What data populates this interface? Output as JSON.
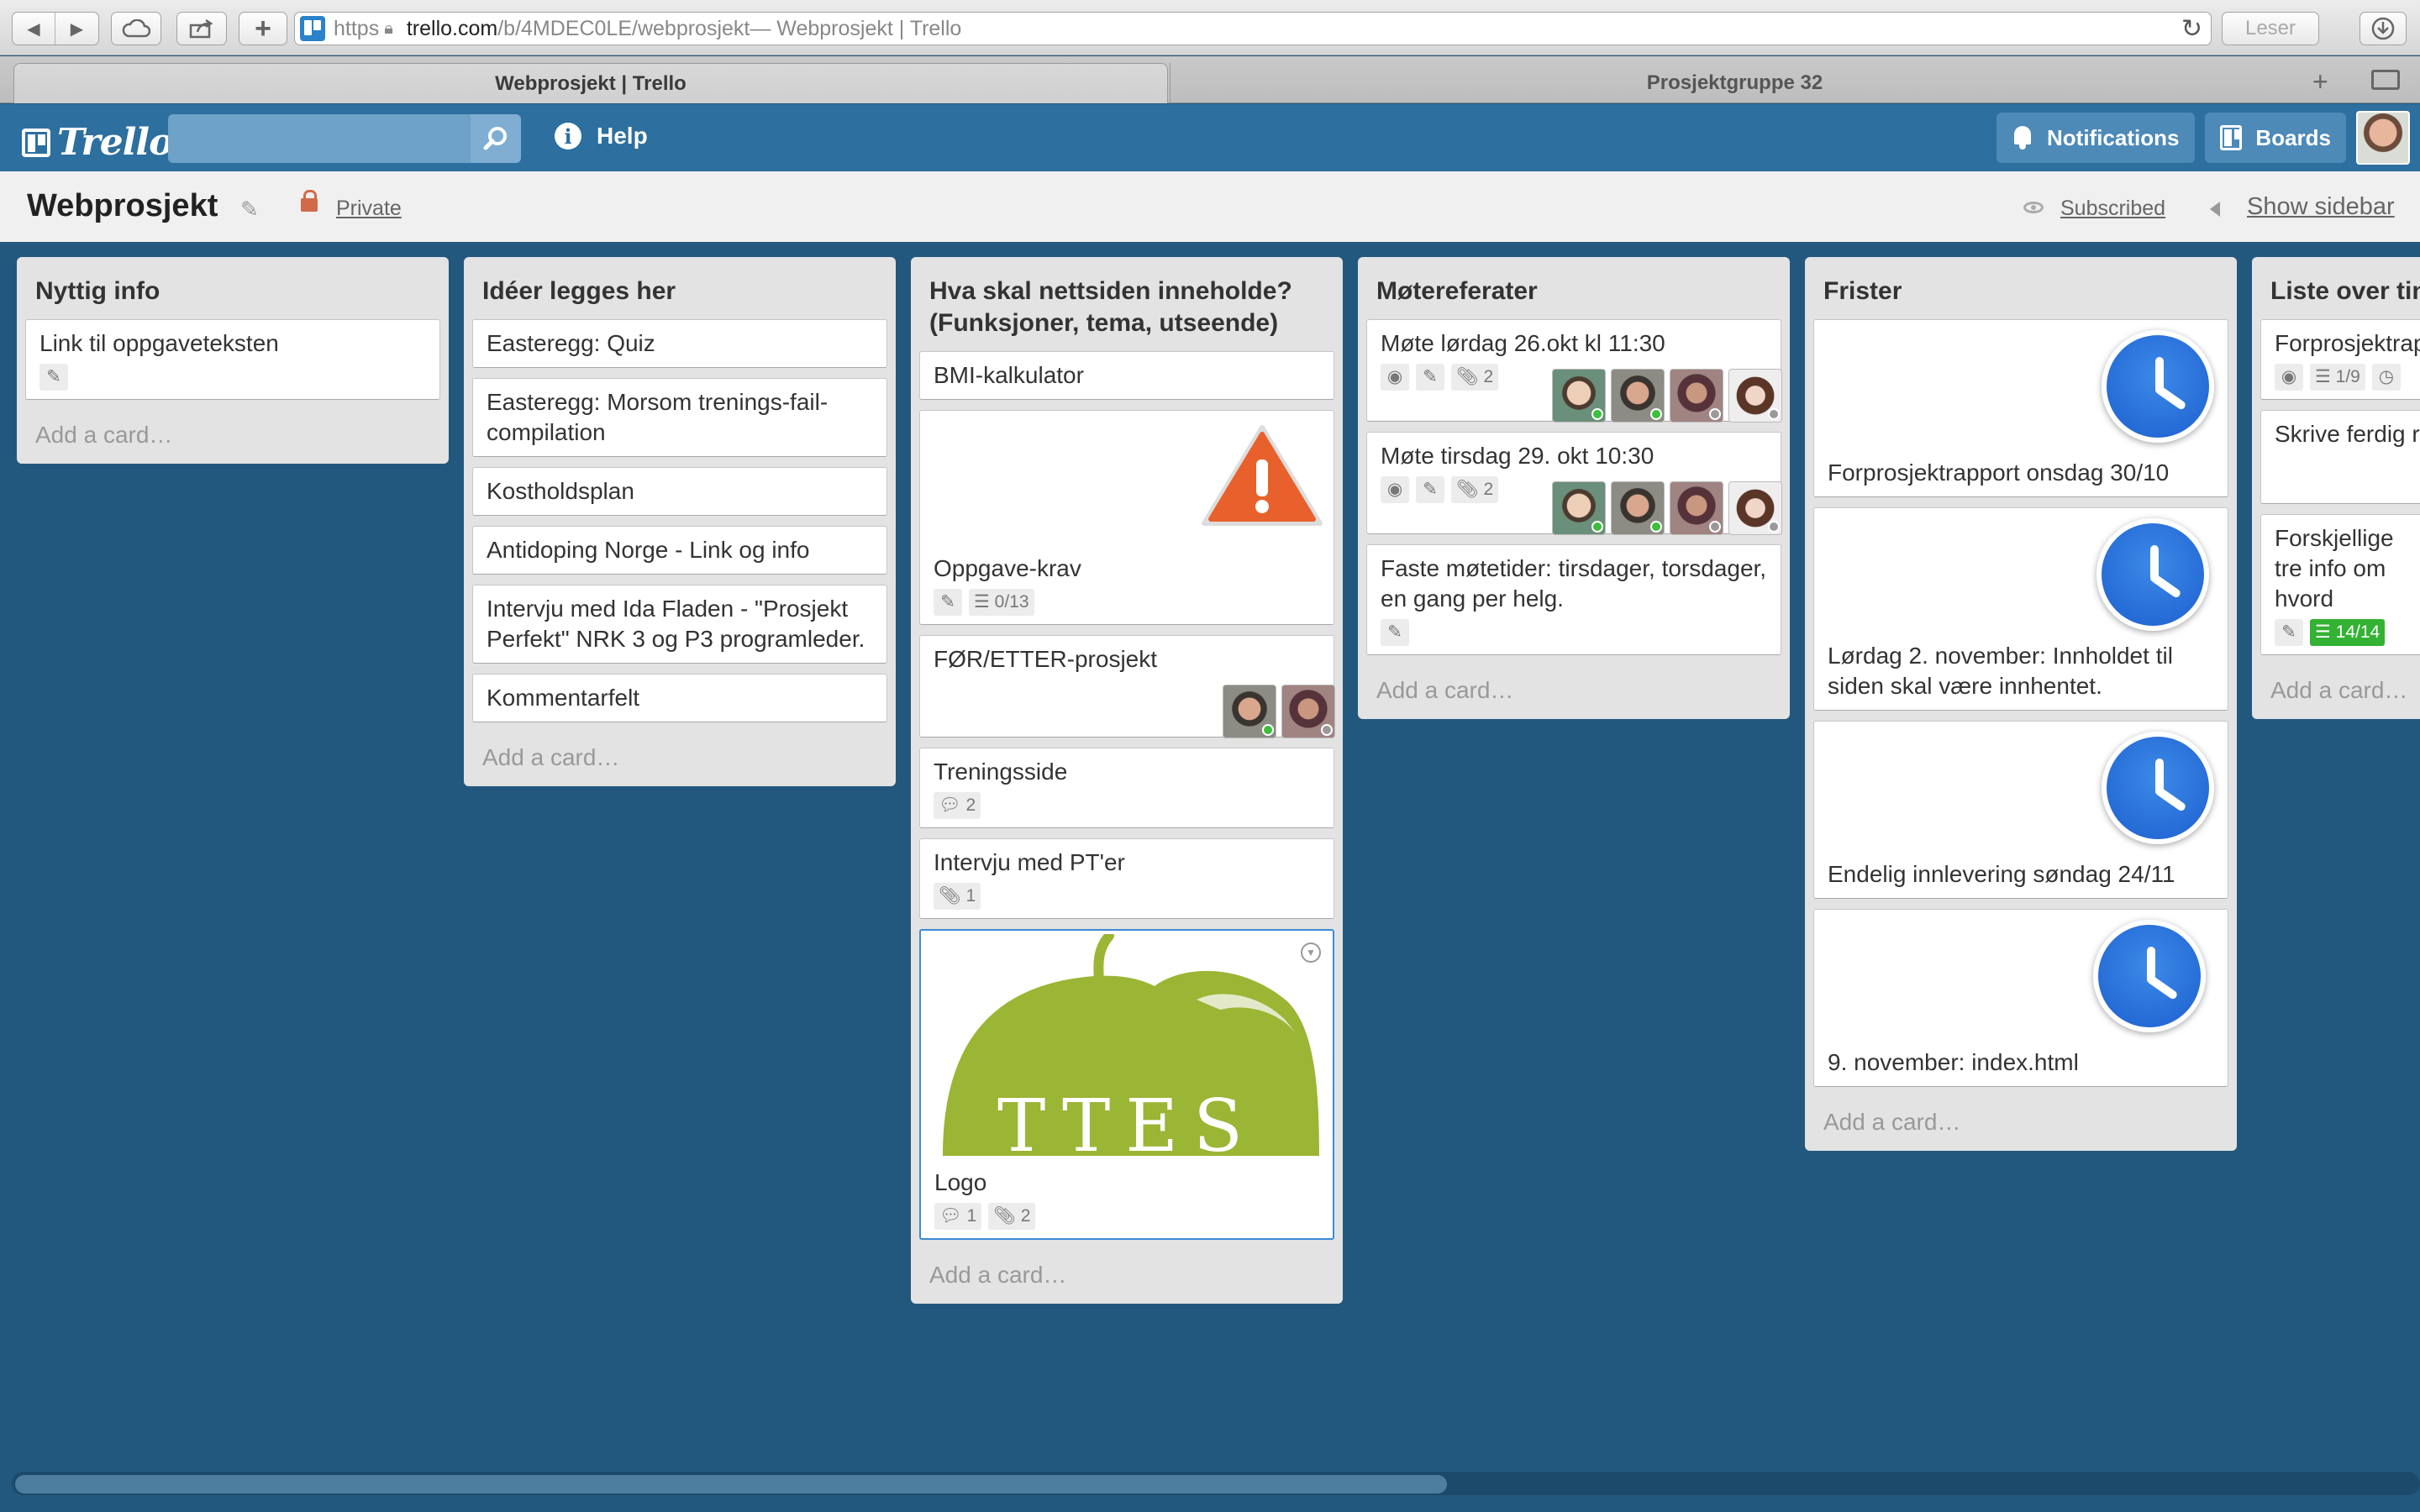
{
  "browser": {
    "url_scheme": "https",
    "url_domain": "trello.com",
    "url_path": "/b/4MDEC0LE/webprosjekt",
    "url_suffix": " — Webprosjekt | Trello",
    "reader_label": "Leser",
    "tabs": [
      {
        "label": "Webprosjekt | Trello"
      },
      {
        "label": "Prosjektgruppe 32"
      }
    ]
  },
  "header": {
    "logo_text": "Trello",
    "help_label": "Help",
    "notifications_label": "Notifications",
    "boards_label": "Boards"
  },
  "board": {
    "title": "Webprosjekt",
    "visibility": "Private",
    "subscribed": "Subscribed",
    "show_sidebar": "Show sidebar"
  },
  "add_card_label": "Add a card…",
  "lists": [
    {
      "title": "Nyttig info",
      "cards": [
        {
          "title": "Link til oppgaveteksten"
        }
      ]
    },
    {
      "title": "Idéer legges her",
      "cards": [
        {
          "title": "Easteregg: Quiz"
        },
        {
          "title": "Easteregg: Morsom trenings-fail-compilation"
        },
        {
          "title": "Kostholdsplan"
        },
        {
          "title": "Antidoping Norge - Link og info"
        },
        {
          "title": "Intervju med Ida Fladen - \"Prosjekt Perfekt\" NRK 3 og P3 programleder."
        },
        {
          "title": "Kommentarfelt"
        }
      ]
    },
    {
      "title": "Hva skal nettsiden inneholde? (Funksjoner, tema, utseende)",
      "cards": [
        {
          "title": "BMI-kalkulator"
        },
        {
          "title": "Oppgave-krav",
          "checklist": "0/13"
        },
        {
          "title": "FØR/ETTER-prosjekt"
        },
        {
          "title": "Treningsside",
          "comments": "2"
        },
        {
          "title": "Intervju med PT'er",
          "attachments": "1"
        },
        {
          "title": "Logo",
          "comments": "1",
          "attachments": "2",
          "cover_text": "TTES"
        }
      ]
    },
    {
      "title": "Møtereferater",
      "cards": [
        {
          "title": "Møte lørdag 26.okt kl 11:30",
          "attachments": "2"
        },
        {
          "title": "Møte tirsdag 29. okt 10:30",
          "attachments": "2"
        },
        {
          "title": "Faste møtetider: tirsdager, torsdager, en gang per helg."
        }
      ]
    },
    {
      "title": "Frister",
      "cards": [
        {
          "title": "Forprosjektrapport onsdag 30/10"
        },
        {
          "title": "Lørdag 2. november: Innholdet til siden skal være innhentet."
        },
        {
          "title": "Endelig innlevering søndag 24/11"
        },
        {
          "title": "9. november: index.html"
        }
      ]
    },
    {
      "title": "Liste over tin",
      "cards": [
        {
          "title": "Forprosjektrap",
          "checklist": "1/9"
        },
        {
          "title": "Skrive ferdig r"
        },
        {
          "title": "Forskjellige tre info om hvord",
          "checklist": "14/14"
        }
      ]
    }
  ],
  "colors": {
    "board_bg": "#23587e",
    "header_bg": "#2d6f9e",
    "list_bg": "#e3e3e3",
    "checklist_done": "#34b233",
    "alert": "#e8612c",
    "logo_green": "#9bb535"
  },
  "icons": [
    "search-icon",
    "info-icon",
    "bell-icon",
    "boards-icon",
    "pencil-icon",
    "lock-icon",
    "eye-icon",
    "checklist-icon",
    "comment-icon",
    "paperclip-icon",
    "clock-icon",
    "alert-icon"
  ]
}
